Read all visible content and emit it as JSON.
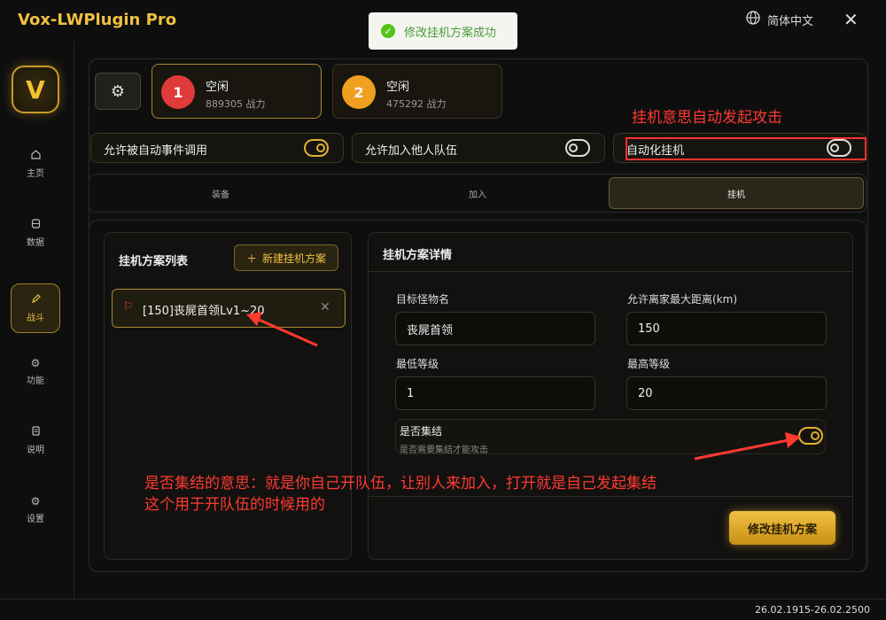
{
  "app": {
    "title": "Vox-LWPlugin Pro",
    "language": "简体中文",
    "close": "✕",
    "version": "26.02.1915-26.02.2500"
  },
  "toast": {
    "message": "修改挂机方案成功"
  },
  "sidebar": {
    "logo": "V",
    "items": [
      {
        "label": "主页",
        "icon": "home-icon"
      },
      {
        "label": "数据",
        "icon": "database-icon"
      },
      {
        "label": "战斗",
        "icon": "pencil-icon",
        "active": true
      },
      {
        "label": "功能",
        "icon": "gear-icon"
      },
      {
        "label": "说明",
        "icon": "document-icon"
      },
      {
        "label": "设置",
        "icon": "settings-icon"
      }
    ]
  },
  "accounts": [
    {
      "num": "1",
      "status": "空闲",
      "power": "889305 战力",
      "color": "#e03a3a"
    },
    {
      "num": "2",
      "status": "空闲",
      "power": "475292 战力",
      "color": "#f0a020"
    }
  ],
  "toggles": [
    {
      "label": "允许被自动事件调用",
      "on": true
    },
    {
      "label": "允许加入他人队伍",
      "on": false
    },
    {
      "label": "自动化挂机",
      "on": false
    }
  ],
  "tabs": [
    "装备",
    "加入",
    "挂机"
  ],
  "plan_list": {
    "title": "挂机方案列表",
    "new_button": "新建挂机方案",
    "items": [
      "[150]丧屍首领Lv1~20"
    ]
  },
  "plan_detail": {
    "title": "挂机方案详情",
    "target_label": "目标怪物名",
    "target_value": "丧屍首领",
    "distance_label": "允许离家最大距离(km)",
    "distance_value": "150",
    "min_label": "最低等级",
    "min_value": "1",
    "max_label": "最高等级",
    "max_value": "20",
    "rally_title": "是否集结",
    "rally_sub": "是否需要集结才能攻击",
    "rally_on": true,
    "save_button": "修改挂机方案"
  },
  "annotations": {
    "auto": "挂机意思自动发起攻击",
    "rally_line1": "是否集结的意思：就是你自己开队伍，让别人来加入，打开就是自己发起集结",
    "rally_line2": "这个用于开队伍的时候用的"
  },
  "colors": {
    "accent": "#f0c040",
    "annotation": "#ff3a30"
  }
}
